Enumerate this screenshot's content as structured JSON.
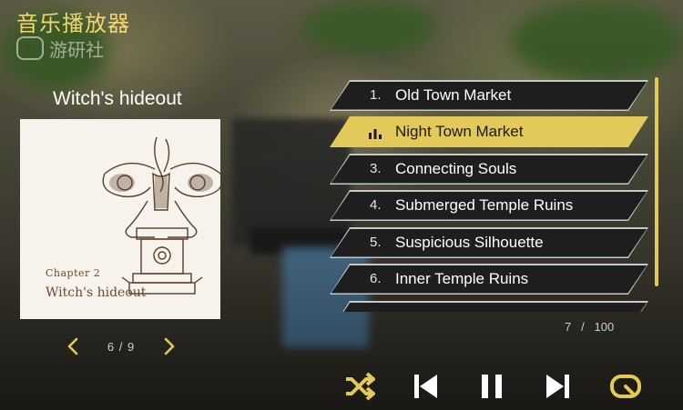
{
  "header": {
    "title": "音乐播放器",
    "watermark": "游研社"
  },
  "album": {
    "name": "Witch's hideout",
    "cover_chapter": "Chapter 2",
    "cover_title": "Witch's hideout",
    "page_current": "6",
    "page_separator": "/",
    "page_total": "9"
  },
  "tracks": [
    {
      "number": "1.",
      "title": "Old Town Market",
      "active": false
    },
    {
      "number": "",
      "title": "Night Town Market",
      "active": true
    },
    {
      "number": "3.",
      "title": "Connecting Souls",
      "active": false
    },
    {
      "number": "4.",
      "title": "Submerged Temple Ruins",
      "active": false
    },
    {
      "number": "5.",
      "title": "Suspicious Silhouette",
      "active": false
    },
    {
      "number": "6.",
      "title": "Inner Temple Ruins",
      "active": false
    }
  ],
  "track_count": {
    "current": "7",
    "separator": "/",
    "total": "100"
  },
  "controls": {
    "shuffle_icon": "shuffle-icon",
    "previous_icon": "skip-previous-icon",
    "pause_icon": "pause-icon",
    "next_icon": "skip-next-icon",
    "repeat_icon": "repeat-icon"
  },
  "colors": {
    "accent": "#e2c95a",
    "title": "#f1d772",
    "track_bg": "#1e1e1e"
  }
}
